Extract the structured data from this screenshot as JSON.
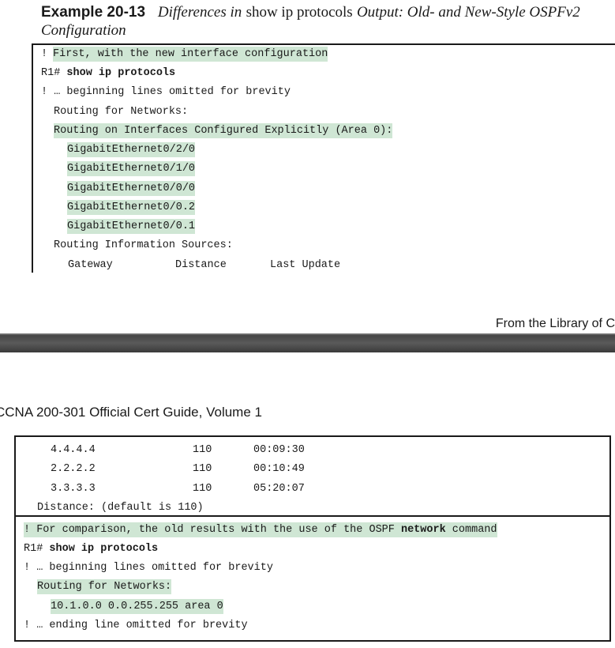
{
  "caption": {
    "number": "Example 20-13",
    "part1": "Differences in",
    "command": "show ip protocols",
    "part2": "Output: Old- and New-Style OSPFv2",
    "part3": "Configuration"
  },
  "top_example": {
    "line1": "! First, with the new interface configuration",
    "prompt1": "R1# ",
    "cmd1": "show ip protocols",
    "line3": "! … beginning lines omitted for brevity",
    "line4": "Routing for Networks:",
    "line5": "Routing on Interfaces Configured Explicitly (Area 0):",
    "interfaces": [
      "GigabitEthernet0/2/0",
      "GigabitEthernet0/1/0",
      "GigabitEthernet0/0/0",
      "GigabitEthernet0/0.2",
      "GigabitEthernet0/0.1"
    ],
    "line_sources": "Routing Information Sources:",
    "col_gateway": "Gateway",
    "col_distance": "Distance",
    "col_update": "Last Update"
  },
  "page_break": {
    "footer": "From the Library of C",
    "header": "CCNA 200-301 Official Cert Guide, Volume 1"
  },
  "sources_table": {
    "rows": [
      {
        "gateway": "4.4.4.4",
        "distance": "110",
        "update": "00:09:30"
      },
      {
        "gateway": "2.2.2.2",
        "distance": "110",
        "update": "00:10:49"
      },
      {
        "gateway": "3.3.3.3",
        "distance": "110",
        "update": "05:20:07"
      }
    ],
    "distance_line": "Distance: (default is 110)"
  },
  "old_example": {
    "comment_a": "! For comparison, the old results with the use of the OSPF ",
    "comment_bold": "network",
    "comment_b": " command",
    "prompt": "R1# ",
    "cmd": "show ip protocols",
    "omitted": "! … beginning lines omitted for brevity",
    "routing": "Routing for Networks:",
    "network": "10.1.0.0 0.0.255.255 area 0",
    "ending": "! … ending line omitted for brevity"
  }
}
